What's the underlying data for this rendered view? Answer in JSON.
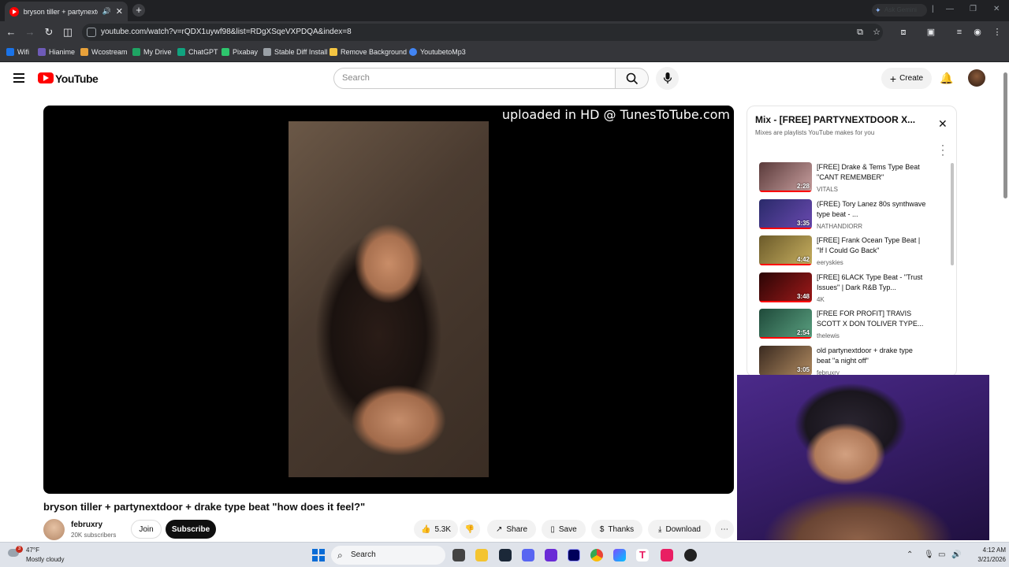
{
  "browser": {
    "tab_title": "bryson tiller + partynextdoor + drake type beat \"how does it feel?\"",
    "url": "youtube.com/watch?v=rQDX1uywf98&list=RDgXSqeVXPDQA&index=8",
    "gemini_label": "Ask Gemini",
    "bookmarks": [
      {
        "label": "Wifi",
        "color": "#1a73e8"
      },
      {
        "label": "Hianime",
        "color": "#6e5bb8"
      },
      {
        "label": "Wcostream",
        "color": "#e8a13a"
      },
      {
        "label": "My Drive",
        "color": "#1fa463"
      },
      {
        "label": "ChatGPT",
        "color": "#10a37f"
      },
      {
        "label": "Pixabay",
        "color": "#2ec66d"
      },
      {
        "label": "Stable Diff Install",
        "color": "#9aa0a6"
      },
      {
        "label": "Remove Background",
        "color": "#f4c542"
      },
      {
        "label": "YoutubetoMp3",
        "color": "#4285f4"
      }
    ]
  },
  "youtube": {
    "brand": "YouTube",
    "search_placeholder": "Search",
    "create_label": "Create"
  },
  "player": {
    "overlay_text": "uploaded in HD @ TunesToTube.com"
  },
  "video": {
    "title": "bryson tiller + partynextdoor + drake type beat \"how does it feel?\"",
    "channel": "februxry",
    "subscribers": "20K subscribers",
    "join_label": "Join",
    "subscribe_label": "Subscribe",
    "likes": "5.3K",
    "share_label": "Share",
    "save_label": "Save",
    "thanks_label": "Thanks",
    "download_label": "Download"
  },
  "playlist": {
    "title": "Mix - [FREE] PARTYNEXTDOOR X...",
    "subtitle": "Mixes are playlists YouTube makes for you",
    "items": [
      {
        "title": "[FREE] Drake & Tems Type Beat \"CANT REMEMBER\"",
        "channel": "VITALS",
        "duration": "2:28",
        "thumb": "#5a3a3a"
      },
      {
        "title": "(FREE) Tory Lanez 80s synthwave type beat - ...",
        "channel": "NATHANDIORR",
        "duration": "3:35",
        "thumb": "#2a2a6a"
      },
      {
        "title": "[FREE] Frank Ocean Type Beat | \"If I Could Go Back\"",
        "channel": "eeryskies",
        "duration": "4:42",
        "thumb": "#6b5a2a"
      },
      {
        "title": "[FREE] 6LACK Type Beat - \"Trust Issues\" | Dark R&B Typ...",
        "channel": "4K",
        "duration": "3:48",
        "thumb": "#6a1010"
      },
      {
        "title": "[FREE FOR PROFIT] TRAVIS SCOTT X DON TOLIVER TYPE...",
        "channel": "thelewis",
        "duration": "2:54",
        "thumb": "#1f4a3a"
      },
      {
        "title": "old partynextdoor + drake type beat \"a night off\"",
        "channel": "februxry",
        "duration": "3:05",
        "thumb": "#7a5a40"
      }
    ]
  },
  "taskbar": {
    "temp": "47°F",
    "condition": "Mostly cloudy",
    "badge": "3",
    "search_label": "Search",
    "time": "4:12 AM",
    "date": "3/21/2026"
  }
}
